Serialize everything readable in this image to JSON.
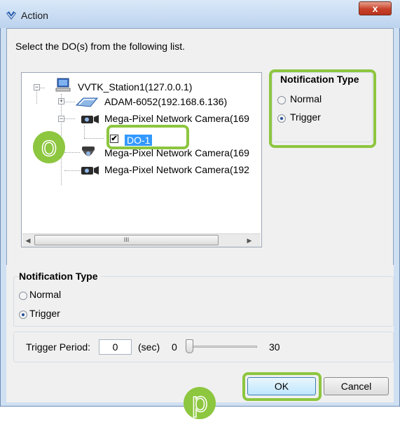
{
  "window": {
    "title": "Action",
    "close_glyph": "x"
  },
  "prompt": "Select the DO(s) from the following list.",
  "tree": {
    "items": [
      {
        "label": "VVTK_Station1(127.0.0.1)",
        "icon": "computer-icon"
      },
      {
        "label": "ADAM-6052(192.168.6.136)",
        "icon": "device-icon"
      },
      {
        "label": "Mega-Pixel Network Camera(169",
        "icon": "camera-icon"
      },
      {
        "label": "DO-1",
        "checked": true
      },
      {
        "label": "Mega-Pixel Network Camera(169",
        "icon": "dome-camera-icon"
      },
      {
        "label": "Mega-Pixel Network Camera(192",
        "icon": "camera-icon"
      }
    ],
    "expander_minus": "−",
    "expander_plus": "+",
    "check_glyph": "✔",
    "scroll_left": "◀",
    "scroll_right": "▶",
    "thumb_grip": "III"
  },
  "notification_right": {
    "title": "Notification Type",
    "options": [
      "Normal",
      "Trigger"
    ],
    "selected": "Trigger"
  },
  "notification_bottom": {
    "title": "Notification Type",
    "options": [
      "Normal",
      "Trigger"
    ],
    "selected": "Trigger"
  },
  "trigger": {
    "label": "Trigger Period:",
    "value": "0",
    "unit": "(sec)",
    "min": "0",
    "max": "30",
    "slider_value": 0
  },
  "buttons": {
    "ok": "OK",
    "cancel": "Cancel"
  },
  "annotations": {
    "o": "o",
    "p": "p"
  },
  "colors": {
    "highlight": "#8dc63f",
    "selection": "#3399ff"
  }
}
